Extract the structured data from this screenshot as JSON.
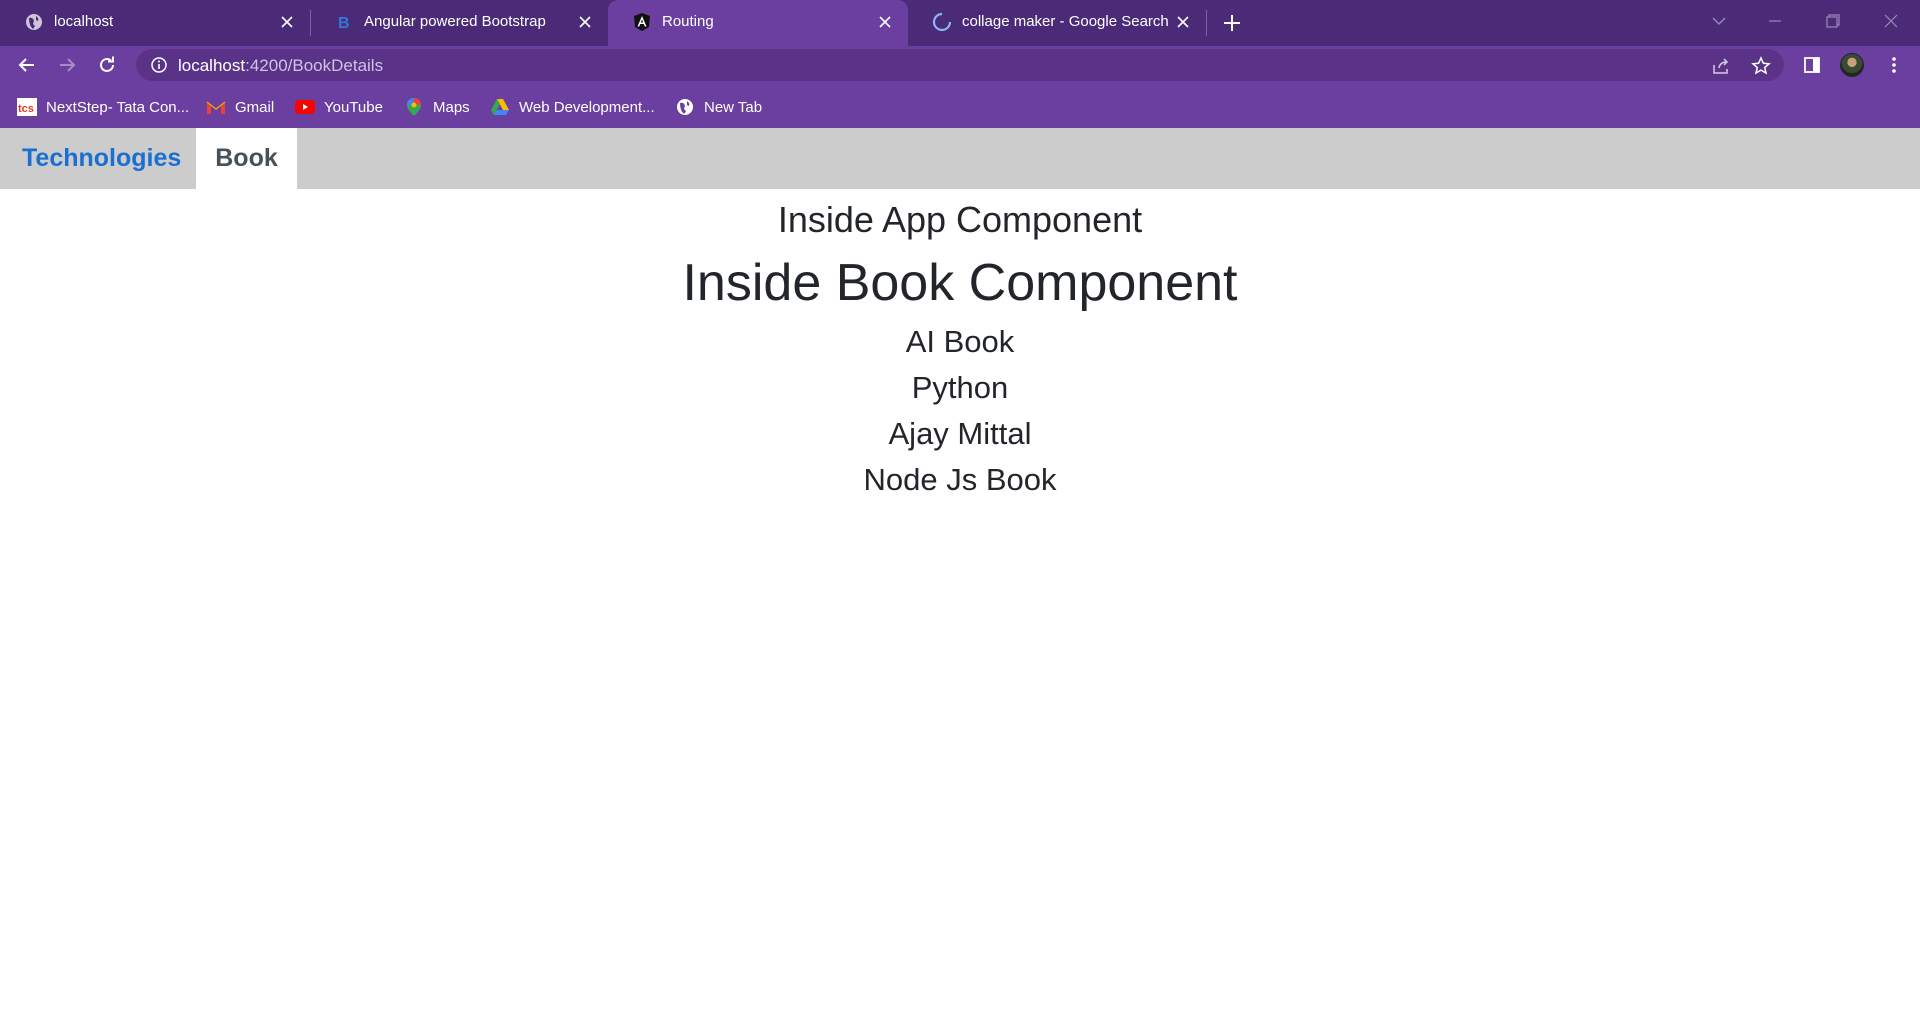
{
  "browser": {
    "tabs": [
      {
        "title": "localhost",
        "favicon": "globe-icon",
        "active": false
      },
      {
        "title": "Angular powered Bootstrap",
        "favicon": "bootstrap-icon",
        "active": false
      },
      {
        "title": "Routing",
        "favicon": "angular-icon",
        "active": true
      },
      {
        "title": "collage maker - Google Search",
        "favicon": "loading-spinner-icon",
        "active": false
      }
    ],
    "address": {
      "host": "localhost",
      "path": ":4200/BookDetails"
    },
    "bookmarks": [
      {
        "label": "NextStep- Tata Con...",
        "icon": "tcs-icon"
      },
      {
        "label": "Gmail",
        "icon": "gmail-icon"
      },
      {
        "label": "YouTube",
        "icon": "youtube-icon"
      },
      {
        "label": "Maps",
        "icon": "maps-icon"
      },
      {
        "label": "Web Development...",
        "icon": "drive-icon"
      },
      {
        "label": "New Tab",
        "icon": "globe-icon"
      }
    ]
  },
  "app": {
    "nav": {
      "technologies": "Technologies",
      "book": "Book"
    },
    "app_heading": "Inside App Component",
    "book_heading": "Inside Book Component",
    "books": [
      "AI Book",
      "Python",
      "Ajay Mittal",
      "Node Js Book"
    ]
  },
  "colors": {
    "tabstrip": "#4b2a77",
    "toolbar": "#6b3fa0",
    "link": "#1a6fd1",
    "navbar": "#cccccc",
    "text": "#222529"
  }
}
